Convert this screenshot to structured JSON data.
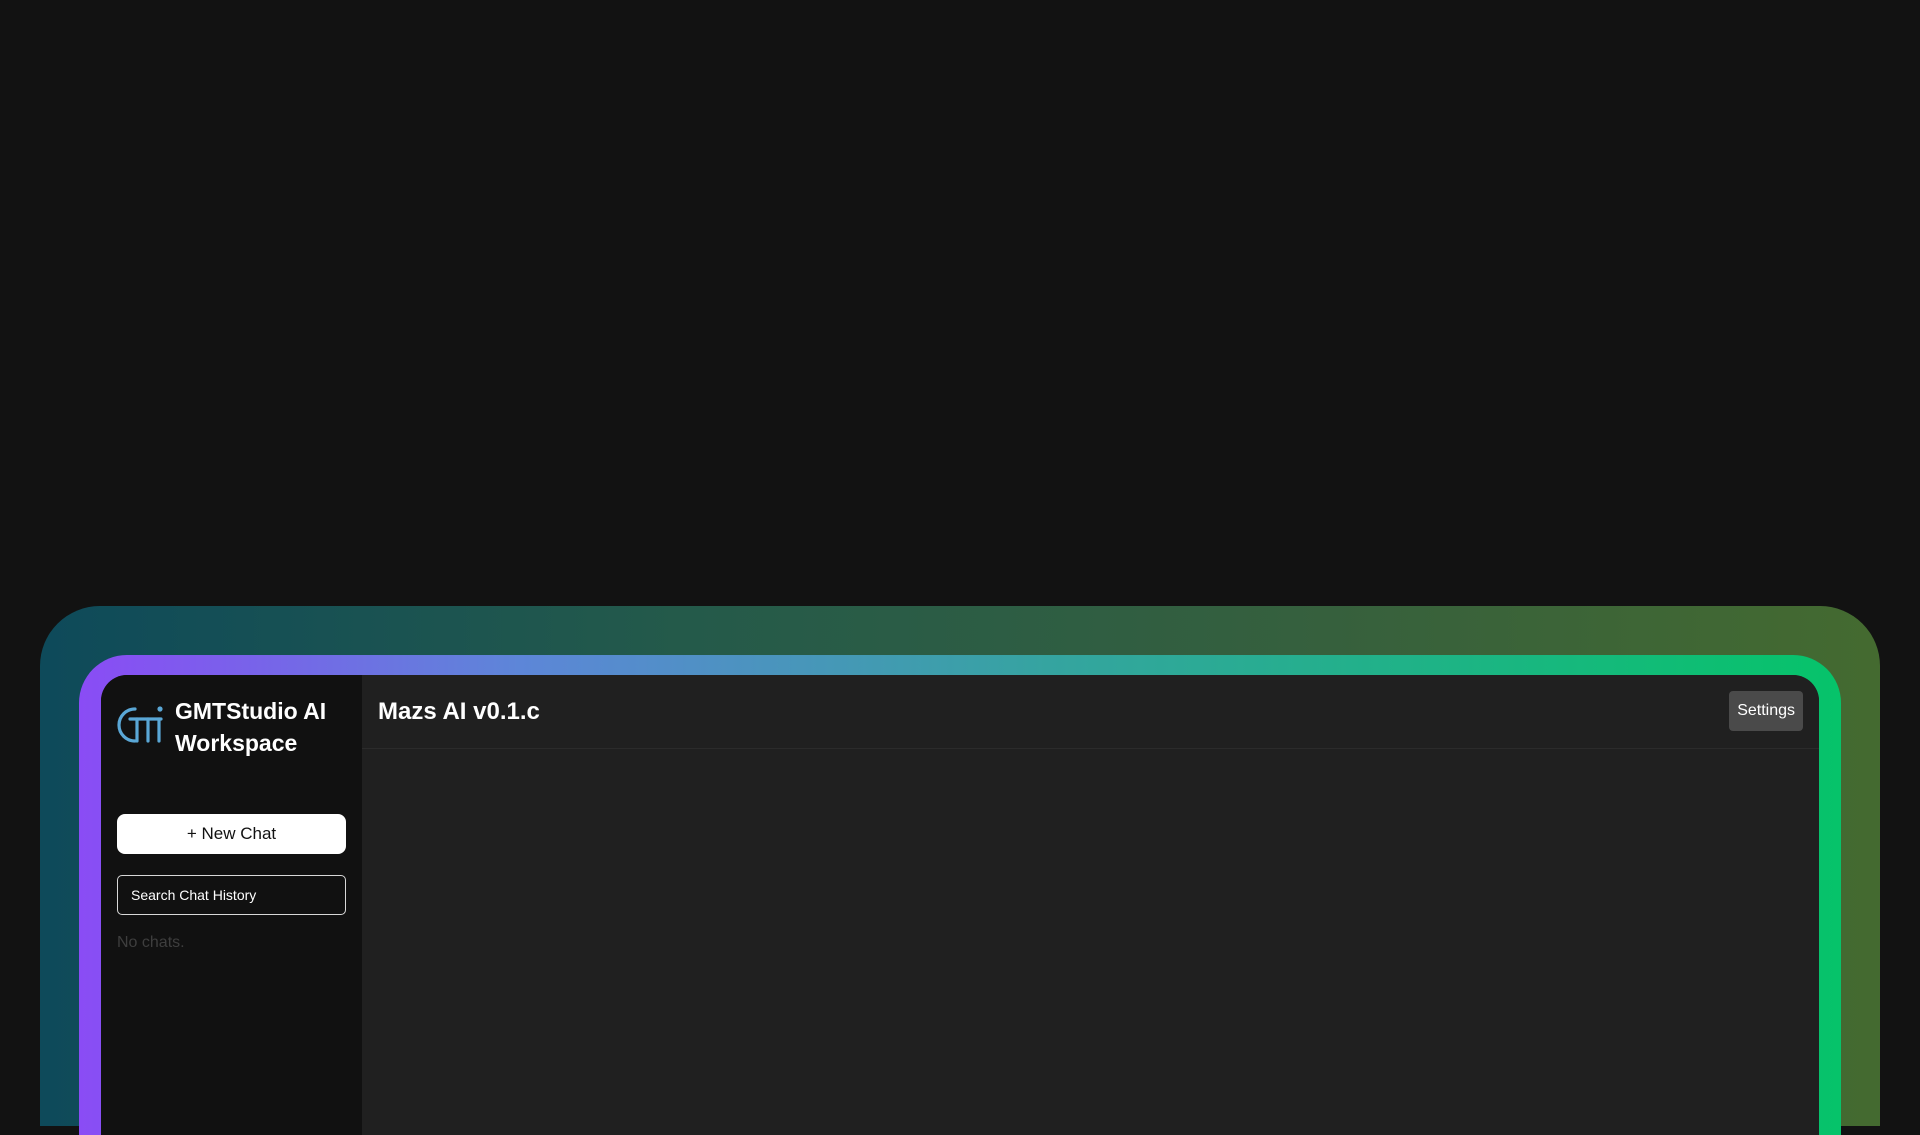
{
  "sidebar": {
    "brand_title": "GMTStudio AI Workspace",
    "logo_icon": "gmt-logo-icon",
    "new_chat_label": "+ New Chat",
    "search_placeholder": "Search Chat History",
    "empty_state": "No chats."
  },
  "header": {
    "model_title": "Mazs AI v0.1.c",
    "settings_label": "Settings"
  },
  "colors": {
    "page_background": "#121212",
    "sidebar_background": "#111111",
    "main_background": "#202020",
    "border_gradient_start": "#8a4cf5",
    "border_gradient_end": "#06c36a",
    "logo_accent": "#5aa7d6"
  }
}
